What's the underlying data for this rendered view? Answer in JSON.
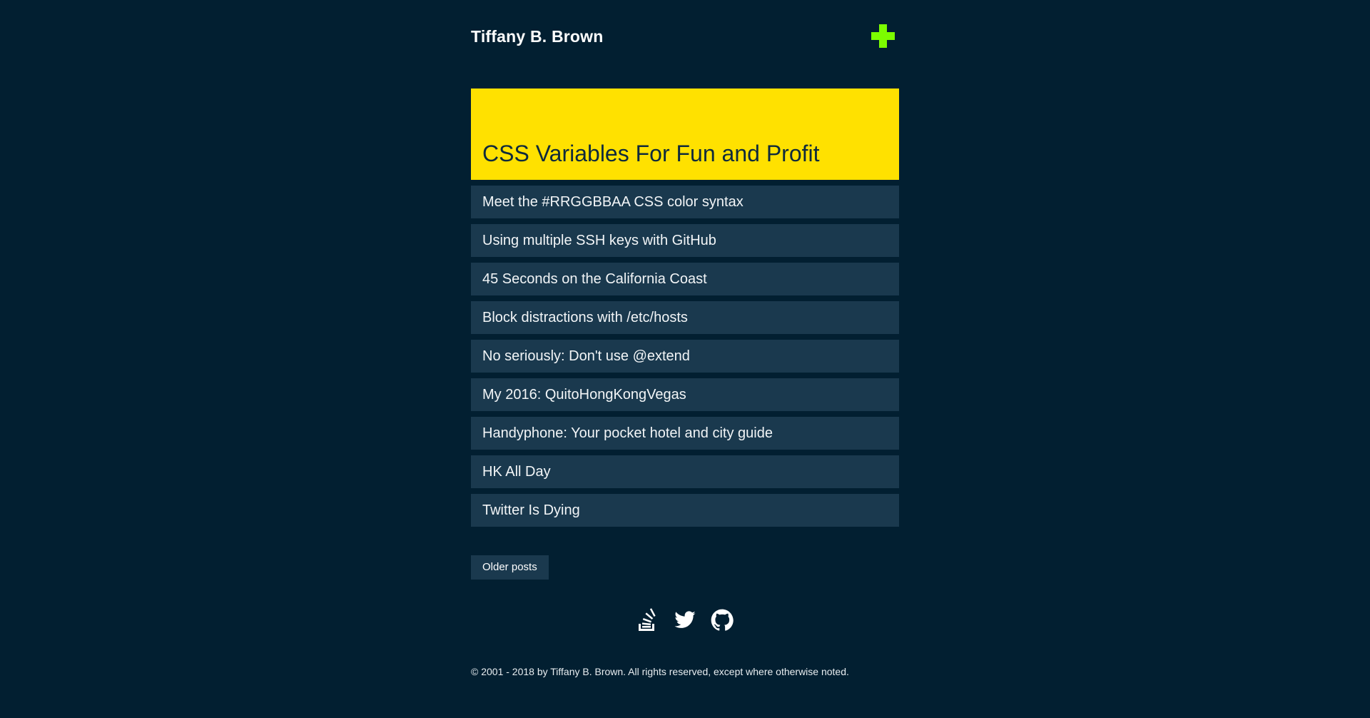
{
  "site": {
    "title": "Tiffany B. Brown"
  },
  "header": {
    "menu_icon": "plus-icon",
    "accent_color": "#7cfc00"
  },
  "featured": {
    "title": "CSS Variables For Fun and Profit",
    "background": "#ffe100"
  },
  "posts": [
    {
      "title": "Meet the #RRGGBBAA CSS color syntax"
    },
    {
      "title": "Using multiple SSH keys with GitHub"
    },
    {
      "title": "45 Seconds on the California Coast"
    },
    {
      "title": "Block distractions with /etc/hosts"
    },
    {
      "title": "No seriously: Don't use @extend"
    },
    {
      "title": "My 2016: QuitoHongKongVegas"
    },
    {
      "title": "Handyphone: Your pocket hotel and city guide"
    },
    {
      "title": "HK All Day"
    },
    {
      "title": "Twitter Is Dying"
    }
  ],
  "pagination": {
    "older_label": "Older posts"
  },
  "social": {
    "icons": [
      "stackoverflow-icon",
      "twitter-icon",
      "github-icon"
    ]
  },
  "footer": {
    "copyright": "© 2001 - 2018 by Tiffany B. Brown. All rights reserved, except where otherwise noted."
  },
  "colors": {
    "background": "#021f31",
    "card": "#1a394e"
  }
}
